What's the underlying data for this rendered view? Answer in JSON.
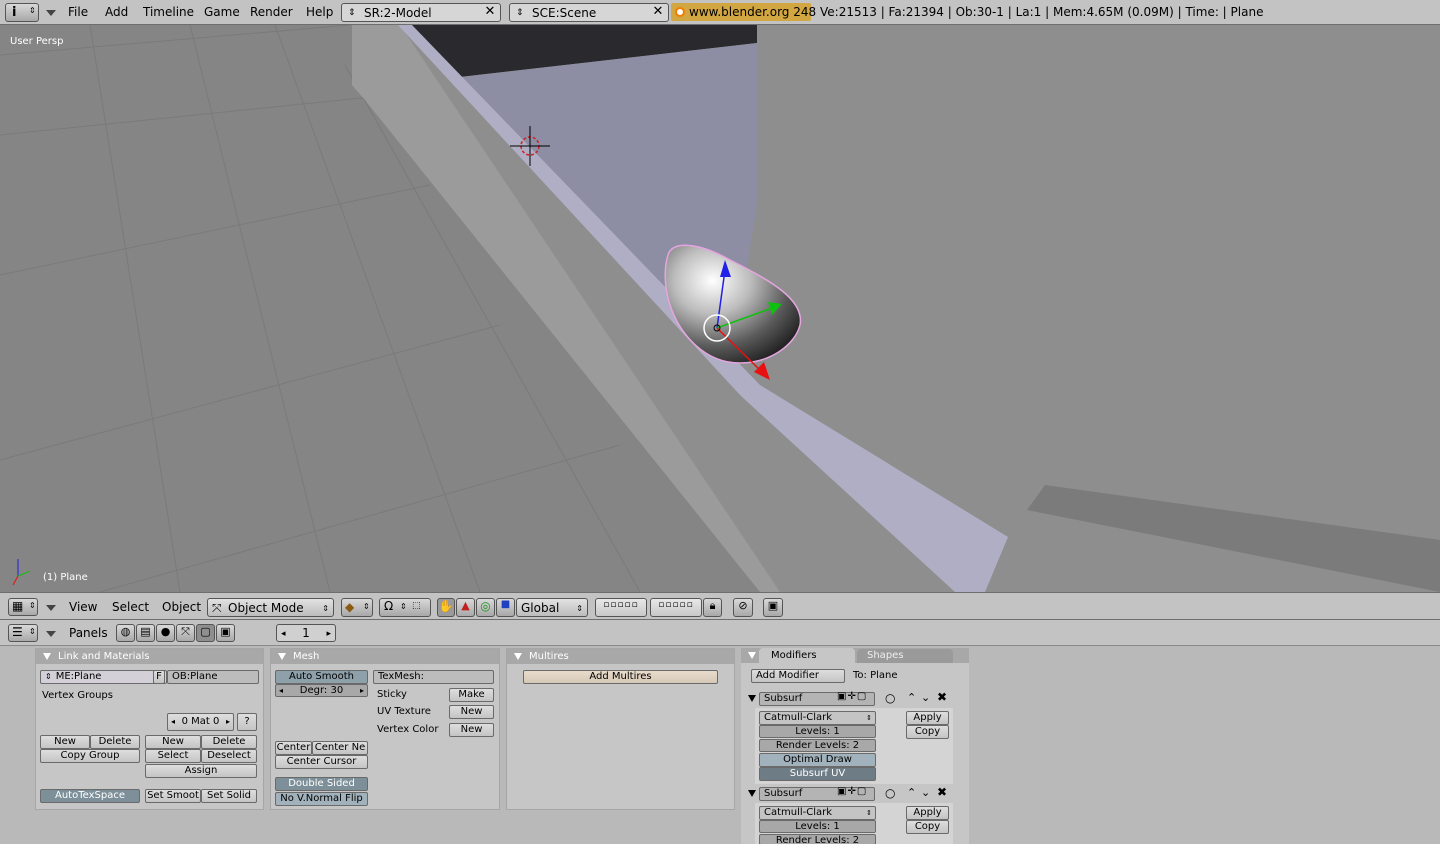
{
  "top_header": {
    "menus": [
      "File",
      "Add",
      "Timeline",
      "Game",
      "Render",
      "Help"
    ],
    "screen": "SR:2-Model",
    "scene": "SCE:Scene",
    "url": "www.blender.org 248",
    "stats": "Ve:21513 | Fa:21394 | Ob:30-1 | La:1  | Mem:4.65M (0.09M)  | Time: | Plane"
  },
  "viewport": {
    "view_label": "User Persp",
    "object_label": "(1) Plane"
  },
  "view3d_header": {
    "menus": [
      "View",
      "Select",
      "Object"
    ],
    "mode": "Object Mode",
    "orientation": "Global"
  },
  "buttons_header": {
    "panels_label": "Panels",
    "frame": "1"
  },
  "link_materials": {
    "title": "Link and Materials",
    "mesh_name": "ME:Plane",
    "fake_user": "F",
    "object_name": "OB:Plane",
    "vertex_groups": "Vertex Groups",
    "mat_count": "0 Mat 0",
    "help": "?",
    "vg_new": "New",
    "vg_delete": "Delete",
    "copy_group": "Copy Group",
    "mat_new": "New",
    "mat_delete": "Delete",
    "select": "Select",
    "deselect": "Deselect",
    "assign": "Assign",
    "autotexspace": "AutoTexSpace",
    "set_smooth": "Set Smoot",
    "set_solid": "Set Solid"
  },
  "mesh": {
    "title": "Mesh",
    "auto_smooth": "Auto Smooth",
    "degr": "Degr: 30",
    "texmesh": "TexMesh:",
    "sticky": "Sticky",
    "sticky_btn": "Make",
    "uv_texture": "UV Texture",
    "uv_btn": "New",
    "vertex_color": "Vertex Color",
    "vc_btn": "New",
    "center": "Center",
    "center_new": "Center Ne",
    "center_cursor": "Center Cursor",
    "double_sided": "Double Sided",
    "no_vnormal_flip": "No V.Normal Flip"
  },
  "multires": {
    "title": "Multires",
    "add_multires": "Add Multires"
  },
  "modifiers": {
    "tab_modifiers": "Modifiers",
    "tab_shapes": "Shapes",
    "add_modifier": "Add Modifier",
    "to": "To: Plane",
    "items": [
      {
        "name": "Subsurf",
        "type": "Catmull-Clark",
        "levels": "Levels: 1",
        "render_levels": "Render Levels: 2",
        "optimal_draw": "Optimal Draw",
        "subsurf_uv": "Subsurf UV",
        "apply": "Apply",
        "copy": "Copy"
      },
      {
        "name": "Subsurf",
        "type": "Catmull-Clark",
        "levels": "Levels: 1",
        "render_levels": "Render Levels: 2",
        "apply": "Apply",
        "copy": "Copy"
      }
    ]
  },
  "colors": {
    "header_bg": "#c3c3c3",
    "viewport_bg": "#8e8e8e",
    "wall_lavender": "#8d8da3",
    "ledge": "#b0aec4",
    "object_outline": "#e6a5e0",
    "axis_x": "#e81010",
    "axis_y": "#10c010",
    "axis_z": "#2020e8",
    "url_bg": "#d2a640"
  }
}
